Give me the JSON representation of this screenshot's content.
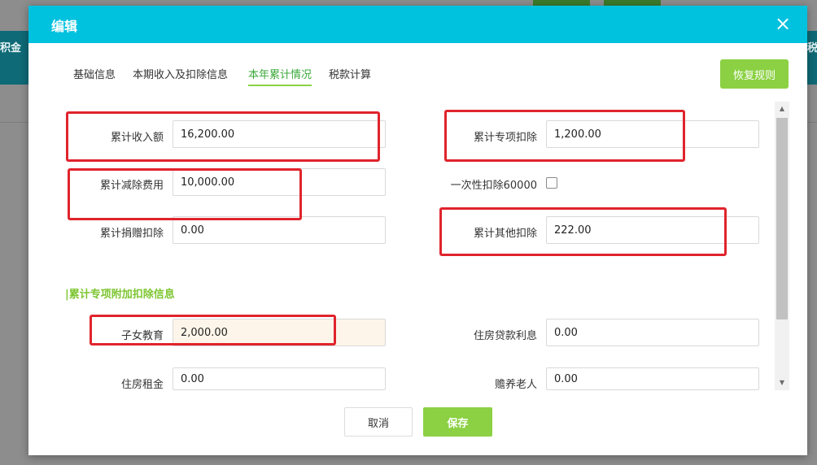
{
  "background": {
    "left_header_text": "积金",
    "right_header_text": "税"
  },
  "dialog": {
    "title": "编辑",
    "close_symbol": "×"
  },
  "tabs": [
    {
      "label": "基础信息",
      "active": false
    },
    {
      "label": "本期收入及扣除信息",
      "active": false
    },
    {
      "label": "本年累计情况",
      "active": true
    },
    {
      "label": "税款计算",
      "active": false
    }
  ],
  "toolbar": {
    "restore_label": "恢复规则"
  },
  "fields": {
    "cumulative_income": {
      "label": "累计收入额",
      "value": "16,200.00"
    },
    "cumulative_special_deduction": {
      "label": "累计专项扣除",
      "value": "1,200.00"
    },
    "cumulative_reduction_expense": {
      "label": "累计减除费用",
      "value": "10,000.00"
    },
    "one_time_deduction": {
      "label": "一次性扣除60000",
      "checked": false
    },
    "cumulative_donation_deduction": {
      "label": "累计捐赠扣除",
      "value": "0.00"
    },
    "cumulative_other_deduction": {
      "label": "累计其他扣除",
      "value": "222.00"
    }
  },
  "section": {
    "title": "|累计专项附加扣除信息"
  },
  "special_fields": {
    "children_education": {
      "label": "子女教育",
      "value": "2,000.00"
    },
    "housing_loan_interest": {
      "label": "住房贷款利息",
      "value": "0.00"
    },
    "housing_rent": {
      "label": "住房租金",
      "value": "0.00"
    },
    "elderly_support": {
      "label": "赡养老人",
      "value": "0.00"
    }
  },
  "scrollbar": {
    "up_symbol": "▲",
    "down_symbol": "▼"
  },
  "footer": {
    "cancel_label": "取消",
    "save_label": "保存"
  },
  "colors": {
    "header": "#00c1de",
    "accent_green": "#8bd143",
    "highlight_red": "#e0242c"
  }
}
